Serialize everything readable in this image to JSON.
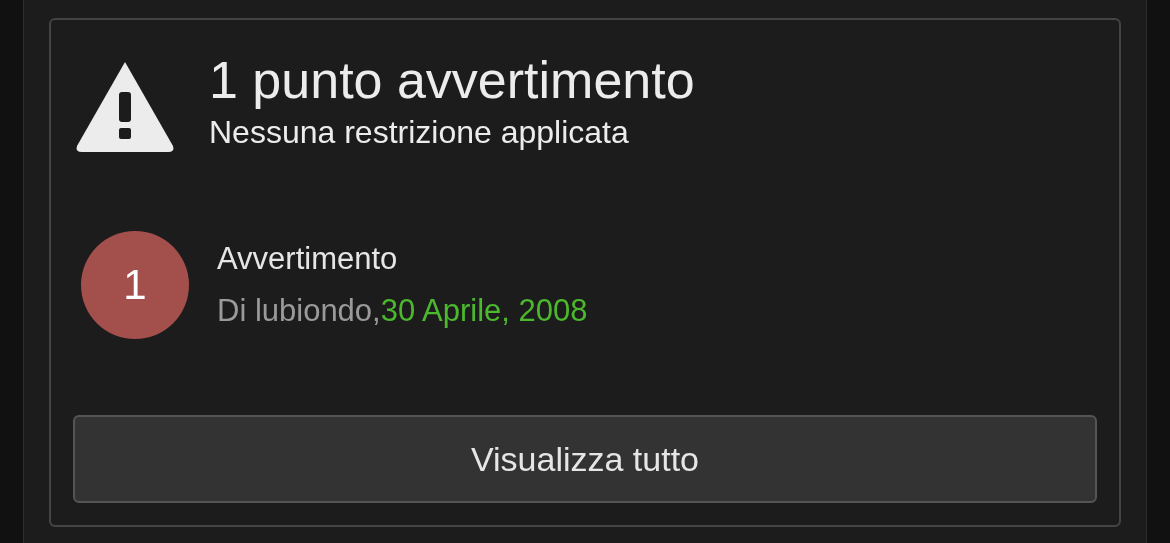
{
  "summary": {
    "title": "1 punto avvertimento",
    "subtitle": "Nessuna restrizione applicata"
  },
  "warnings": [
    {
      "number": "1",
      "label": "Avvertimento",
      "byline": "Di lubiondo,",
      "date": "30 Aprile, 2008"
    }
  ],
  "button": {
    "label": "Visualizza tutto"
  }
}
